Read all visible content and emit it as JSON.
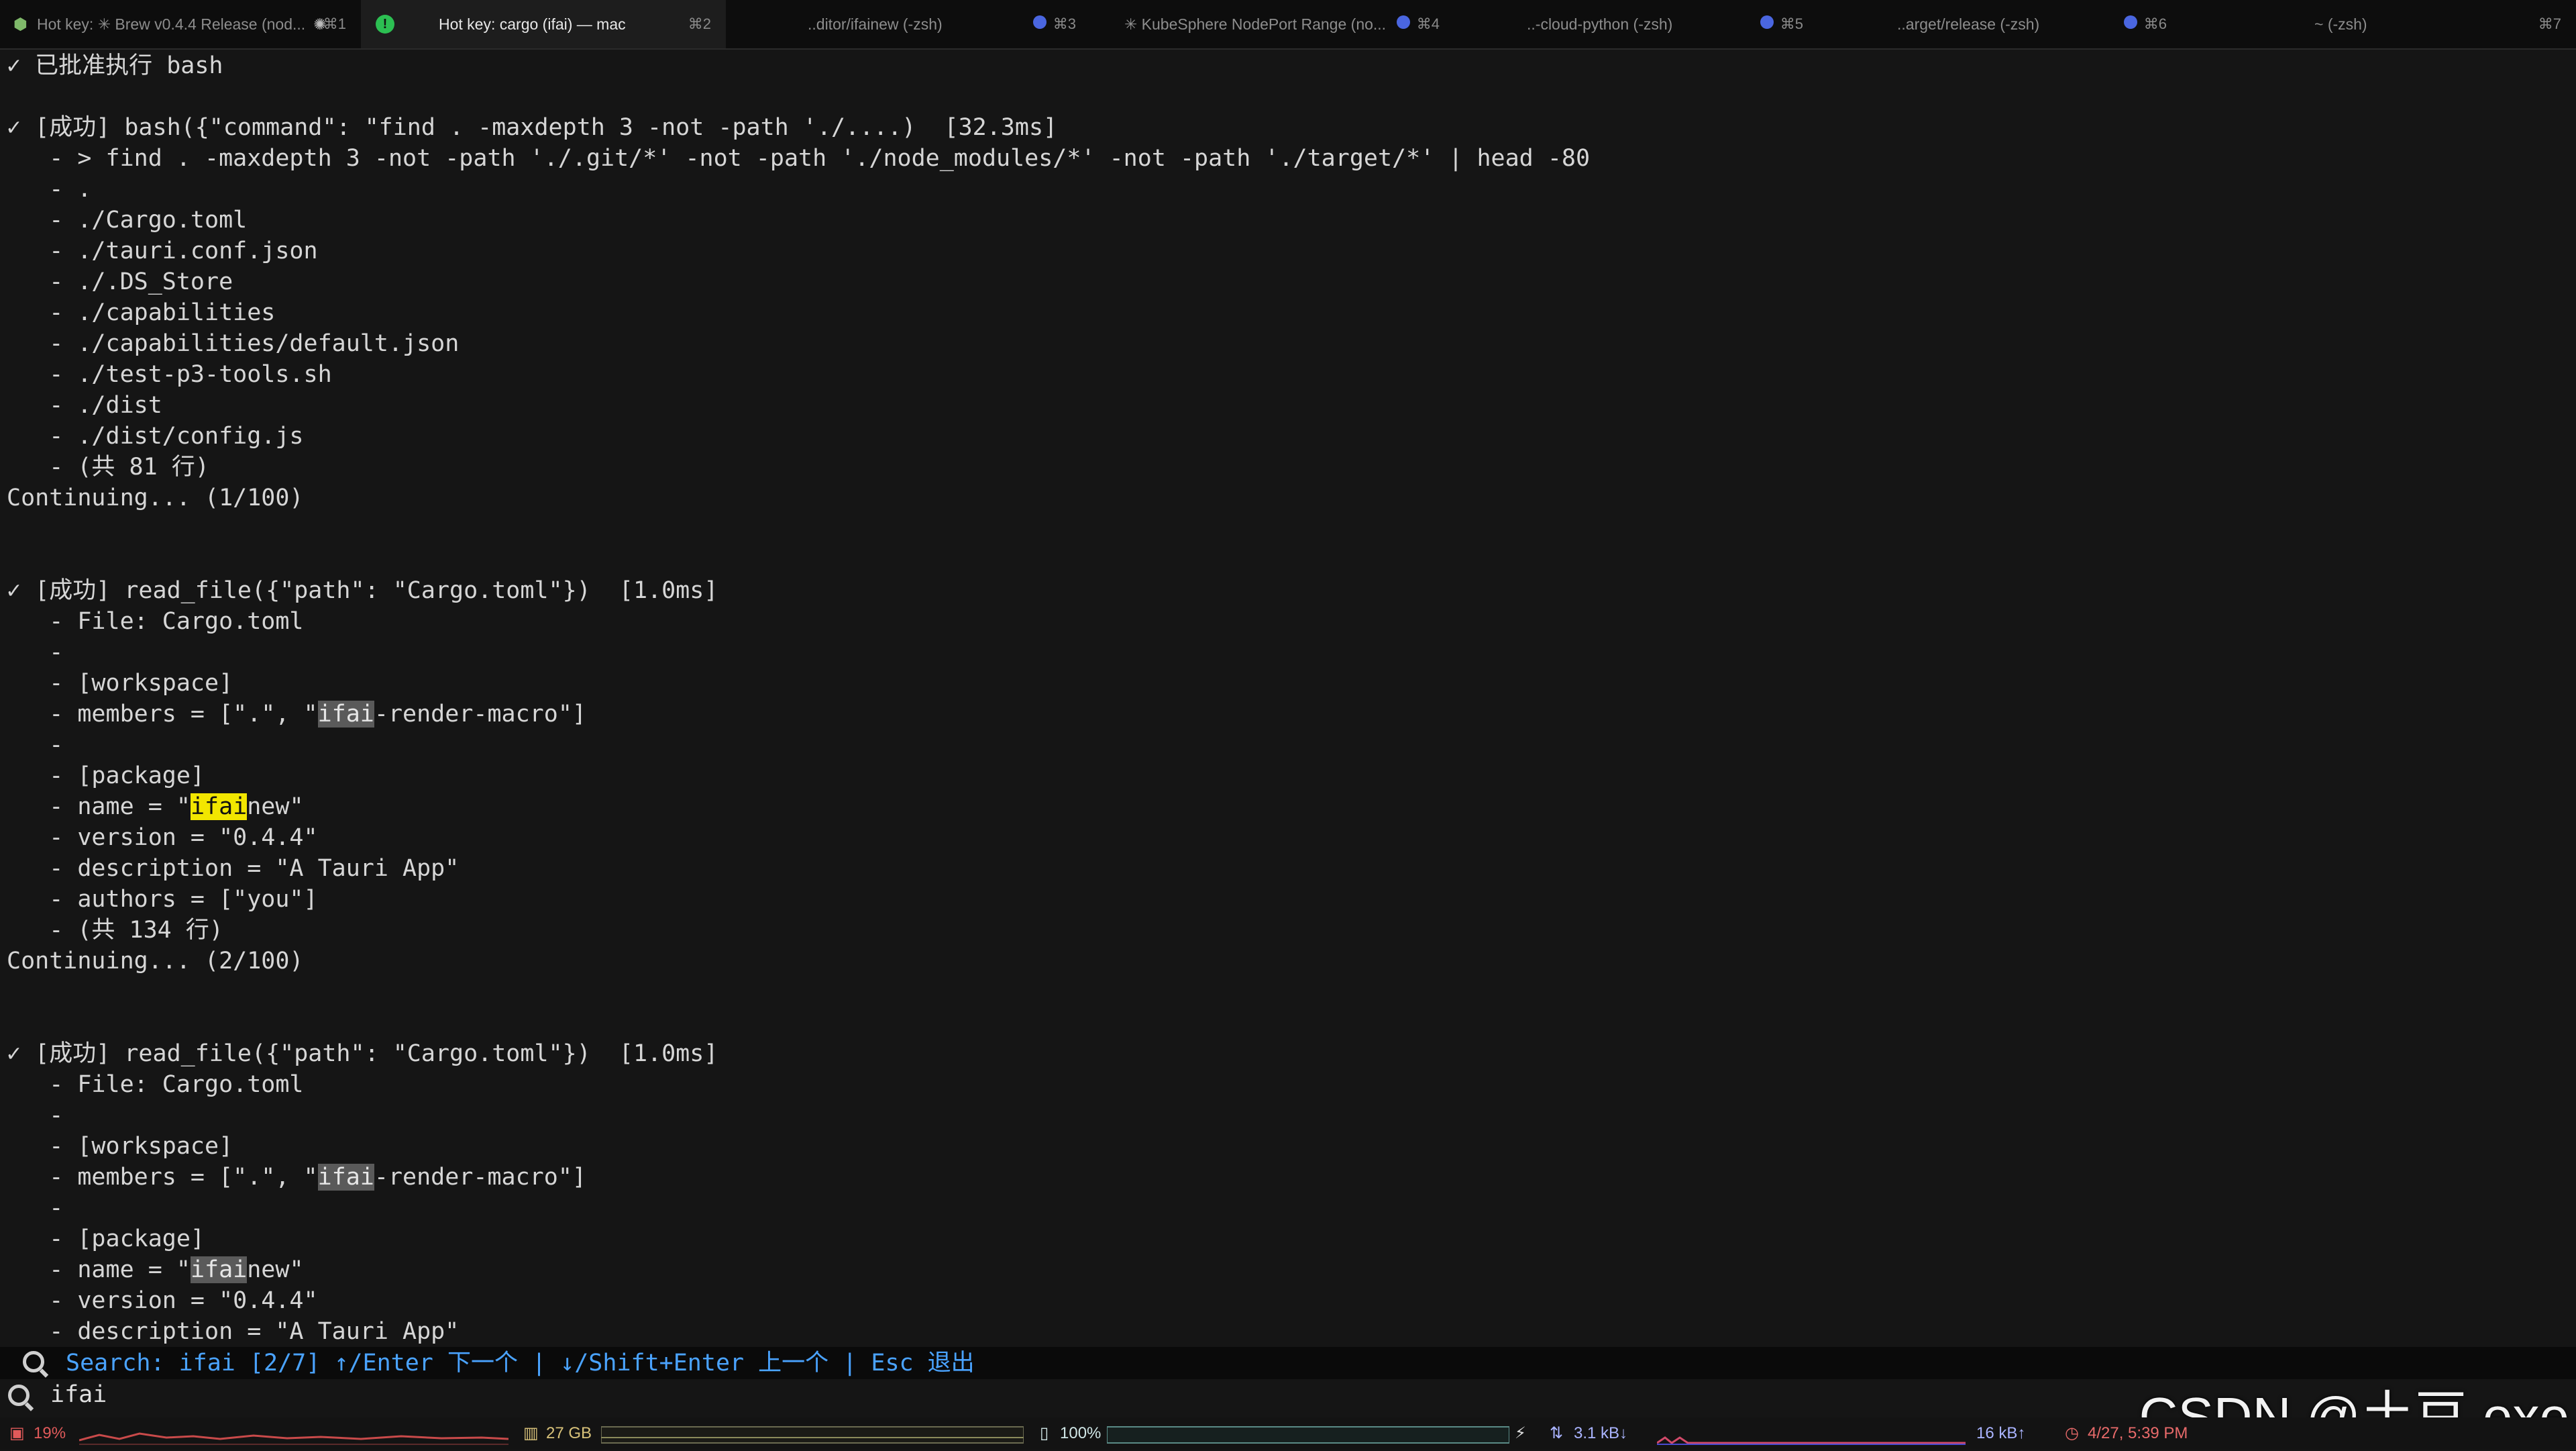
{
  "tabs": [
    {
      "label": "Hot key: ✳ Brew v0.4.4 Release (nod...",
      "shortcut": "⌘1"
    },
    {
      "label": "Hot key: cargo (ifai) — mac",
      "shortcut": "⌘2"
    },
    {
      "label": "..ditor/ifainew (-zsh)",
      "shortcut": "⌘3"
    },
    {
      "label": "✳ KubeSphere NodePort Range (no...",
      "shortcut": "⌘4"
    },
    {
      "label": "..-cloud-python (-zsh)",
      "shortcut": "⌘5"
    },
    {
      "label": "..arget/release (-zsh)",
      "shortcut": "⌘6"
    },
    {
      "label": "~ (-zsh)",
      "shortcut": "⌘7"
    }
  ],
  "terminal": {
    "approved": "✓ 已批准执行 bash",
    "block1": {
      "header": "✓ [成功] bash({\"command\": \"find . -maxdepth 3 -not -path './....)  [32.3ms]",
      "lines": [
        "   - > find . -maxdepth 3 -not -path './.git/*' -not -path './node_modules/*' -not -path './target/*' | head -80",
        "   - .",
        "   - ./Cargo.toml",
        "   - ./tauri.conf.json",
        "   - ./.DS_Store",
        "   - ./capabilities",
        "   - ./capabilities/default.json",
        "   - ./test-p3-tools.sh",
        "   - ./dist",
        "   - ./dist/config.js",
        "   - (共 81 行)"
      ],
      "continuing": "Continuing... (1/100)"
    },
    "block2": {
      "header": "✓ [成功] read_file({\"path\": \"Cargo.toml\"})  [1.0ms]",
      "file": "   - File: Cargo.toml",
      "dash": "   -",
      "workspace": "   - [workspace]",
      "members_pre": "   - members = [\".\", \"",
      "members_hl": "ifai",
      "members_post": "-render-macro\"]",
      "package": "   - [package]",
      "name_pre": "   - name = \"",
      "name_hl": "ifai",
      "name_post": "new\"",
      "version": "   - version = \"0.4.4\"",
      "description": "   - description = \"A Tauri App\"",
      "authors": "   - authors = [\"you\"]",
      "count": "   - (共 134 行)",
      "continuing": "Continuing... (2/100)"
    },
    "block3": {
      "header": "✓ [成功] read_file({\"path\": \"Cargo.toml\"})  [1.0ms]",
      "file": "   - File: Cargo.toml",
      "dash": "   -",
      "workspace": "   - [workspace]",
      "members_pre": "   - members = [\".\", \"",
      "members_hl": "ifai",
      "members_post": "-render-macro\"]",
      "package": "   - [package]",
      "name_pre": "   - name = \"",
      "name_hl": "ifai",
      "name_post": "new\"",
      "version": "   - version = \"0.4.4\"",
      "description": "   - description = \"A Tauri App\""
    }
  },
  "search": {
    "status": "Search: ifai [2/7] ↑/Enter 下一个 | ↓/Shift+Enter 上一个 | Esc 退出",
    "query": "ifai"
  },
  "statusbar": {
    "cpu": "19%",
    "memory": "27 GB",
    "battery": "100%",
    "net_down": "3.1 kB↓",
    "net_up": "16 kB↑",
    "datetime": "4/27, 5:39 PM"
  },
  "watermark": "CSDN @土豆.exe",
  "colors": {
    "search_text": "#4aa3ff",
    "highlight_current": "#f2e600",
    "highlight": "#5a5a5a"
  }
}
